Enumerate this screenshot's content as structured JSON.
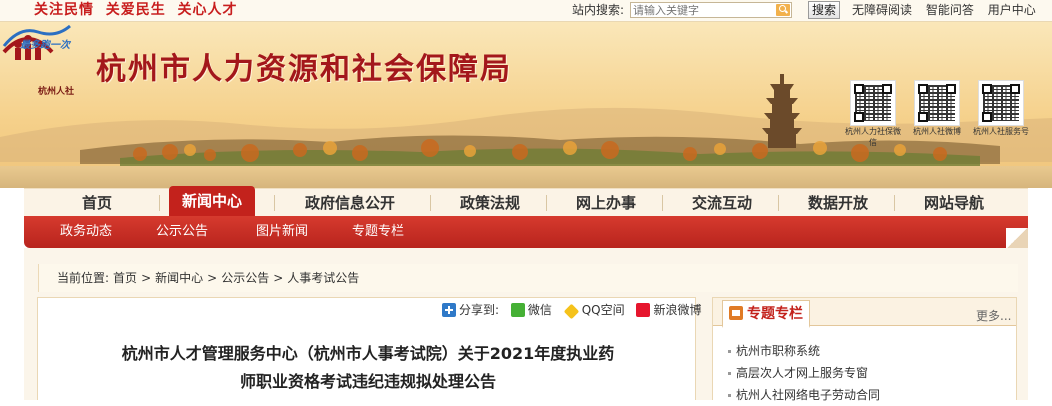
{
  "topbar": {
    "slogan": "关注民情  关爱民生  关心人才",
    "site_search_label": "站内搜索:",
    "search_placeholder": "请输入关键字",
    "search_button": "搜索",
    "links": [
      "无障碍阅读",
      "智能问答",
      "用户中心"
    ]
  },
  "banner": {
    "emblem_text": "杭州人社",
    "site_title": "杭州市人力资源和社会保障局",
    "service_logo_text": "最多跑一次",
    "qr_captions": [
      "杭州人力社保微信",
      "杭州人社微博",
      "杭州人社服务号"
    ]
  },
  "nav": {
    "items": [
      "首页",
      "新闻中心",
      "政府信息公开",
      "政策法规",
      "网上办事",
      "交流互动",
      "数据开放",
      "网站导航"
    ],
    "active_index": 1
  },
  "subnav": {
    "items": [
      "政务动态",
      "公示公告",
      "图片新闻",
      "专题专栏"
    ]
  },
  "breadcrumb": {
    "label": "当前位置:",
    "items": [
      "首页",
      "新闻中心",
      "公示公告",
      "人事考试公告"
    ]
  },
  "share": {
    "label": "分享到:",
    "targets": [
      "微信",
      "QQ空间",
      "新浪微博"
    ]
  },
  "article": {
    "title_line1": "杭州市人才管理服务中心（杭州市人事考试院）关于2021年度执业药",
    "title_line2": "师职业资格考试违纪违规拟处理公告"
  },
  "sidebar": {
    "title": "专题专栏",
    "more": "更多...",
    "items": [
      "杭州市职称系统",
      "高层次人才网上服务专窗",
      "杭州人社网络电子劳动合同"
    ]
  },
  "colors": {
    "brand_red": "#c3221c",
    "slogan_red": "#c81e1e",
    "banner_gold": "#f6d38f"
  }
}
